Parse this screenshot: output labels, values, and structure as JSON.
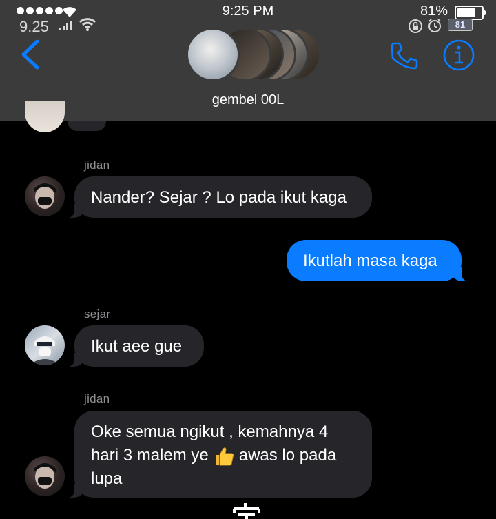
{
  "status_bar": {
    "carrier": "9.25",
    "time": "9:25 PM",
    "battery_percent": "81%",
    "battery_badge": "81"
  },
  "header": {
    "group_name": "gembel 00L",
    "accent_color": "#0a7cff"
  },
  "messages": [
    {
      "sender": "jidan",
      "text": "Nander? Sejar ? Lo pada ikut kaga",
      "direction": "incoming"
    },
    {
      "text": "Ikutlah masa kaga",
      "direction": "outgoing"
    },
    {
      "sender": "sejar",
      "text": "Ikut aee gue",
      "direction": "incoming"
    },
    {
      "sender": "jidan",
      "line1": "Oke semua ngikut , kemahnya 4",
      "line2a": "hari 3 malem ye",
      "line2b": "awas lo pada",
      "line3": "lupa",
      "emoji": "thumbs-up-icon",
      "direction": "incoming"
    }
  ],
  "icons": [
    "back-chevron-icon",
    "phone-icon",
    "info-icon",
    "wifi-icon",
    "signal-icon",
    "lock-icon",
    "alarm-icon",
    "battery-icon",
    "thumbs-up-icon"
  ]
}
